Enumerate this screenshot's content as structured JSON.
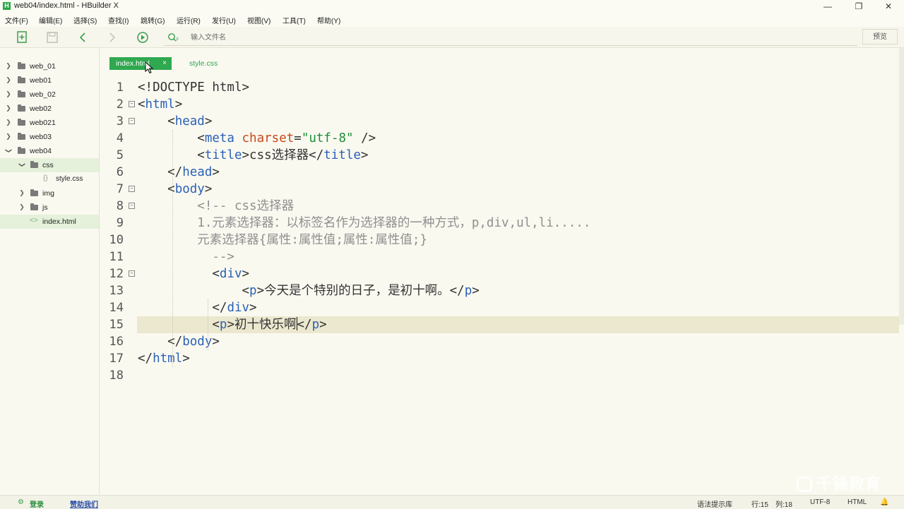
{
  "window": {
    "title": "web04/index.html - HBuilder X",
    "app_icon_letter": "H",
    "minimize": "—",
    "restore": "❐",
    "close": "✕"
  },
  "menu": [
    "文件(F)",
    "编辑(E)",
    "选择(S)",
    "查找(I)",
    "跳转(G)",
    "运行(R)",
    "发行(U)",
    "视图(V)",
    "工具(T)",
    "帮助(Y)"
  ],
  "toolbar": {
    "search_placeholder": "输入文件名",
    "preview_label": "预览",
    "icons": [
      "new-file-icon",
      "save-icon",
      "back-icon",
      "forward-icon",
      "run-icon",
      "search-icon"
    ]
  },
  "sidebar": {
    "items": [
      {
        "label": "web_01",
        "type": "folder",
        "depth": 0,
        "state": "collapsed",
        "selected": false
      },
      {
        "label": "web01",
        "type": "folder",
        "depth": 0,
        "state": "collapsed",
        "selected": false
      },
      {
        "label": "web_02",
        "type": "folder",
        "depth": 0,
        "state": "collapsed",
        "selected": false
      },
      {
        "label": "web02",
        "type": "folder",
        "depth": 0,
        "state": "collapsed",
        "selected": false
      },
      {
        "label": "web021",
        "type": "folder",
        "depth": 0,
        "state": "collapsed",
        "selected": false
      },
      {
        "label": "web03",
        "type": "folder",
        "depth": 0,
        "state": "collapsed",
        "selected": false
      },
      {
        "label": "web04",
        "type": "folder",
        "depth": 0,
        "state": "expanded",
        "selected": false
      },
      {
        "label": "css",
        "type": "folder",
        "depth": 1,
        "state": "expanded",
        "selected": true
      },
      {
        "label": "style.css",
        "type": "css-file",
        "depth": 2,
        "state": "",
        "selected": false
      },
      {
        "label": "img",
        "type": "folder",
        "depth": 1,
        "state": "collapsed",
        "selected": false
      },
      {
        "label": "js",
        "type": "folder",
        "depth": 1,
        "state": "collapsed",
        "selected": false
      },
      {
        "label": "index.html",
        "type": "html-file",
        "depth": 1,
        "state": "",
        "selected": true
      }
    ],
    "css_glyph": "{}",
    "html_glyph": "<>"
  },
  "editor": {
    "tabs": [
      {
        "label": "index.html",
        "active": true,
        "close": "×"
      },
      {
        "label": "style.css",
        "active": false
      }
    ],
    "current_line": 15,
    "lines": [
      {
        "n": "1",
        "fold": "",
        "segments": [
          [
            "pt",
            "<!DOCTYPE html>"
          ]
        ]
      },
      {
        "n": "2",
        "fold": "⊟",
        "segments": [
          [
            "pt",
            "<"
          ],
          [
            "tg",
            "html"
          ],
          [
            "pt",
            ">"
          ]
        ]
      },
      {
        "n": "3",
        "fold": "⊟",
        "segments": [
          [
            "pt",
            "    <"
          ],
          [
            "tg",
            "head"
          ],
          [
            "pt",
            ">"
          ]
        ]
      },
      {
        "n": "4",
        "fold": "",
        "segments": [
          [
            "pt",
            "        <"
          ],
          [
            "tg",
            "meta "
          ],
          [
            "at",
            "charset"
          ],
          [
            "pt",
            "="
          ],
          [
            "st",
            "\"utf-8\""
          ],
          [
            "pt",
            " />"
          ]
        ]
      },
      {
        "n": "5",
        "fold": "",
        "segments": [
          [
            "pt",
            "        <"
          ],
          [
            "tg",
            "title"
          ],
          [
            "pt",
            ">css选择器</"
          ],
          [
            "tg",
            "title"
          ],
          [
            "pt",
            ">"
          ]
        ]
      },
      {
        "n": "6",
        "fold": "",
        "segments": [
          [
            "pt",
            "    </"
          ],
          [
            "tg",
            "head"
          ],
          [
            "pt",
            ">"
          ]
        ]
      },
      {
        "n": "7",
        "fold": "⊟",
        "segments": [
          [
            "pt",
            "    <"
          ],
          [
            "tg",
            "body"
          ],
          [
            "pt",
            ">"
          ]
        ]
      },
      {
        "n": "8",
        "fold": "⊟",
        "segments": [
          [
            "cm",
            "        <!-- css选择器"
          ]
        ]
      },
      {
        "n": "9",
        "fold": "",
        "segments": [
          [
            "cm",
            "        1.元素选择器：以标签名作为选择器的一种方式，p,div,ul,li....."
          ]
        ]
      },
      {
        "n": "10",
        "fold": "",
        "segments": [
          [
            "cm",
            "        元素选择器{属性:属性值;属性:属性值;}"
          ]
        ]
      },
      {
        "n": "11",
        "fold": "",
        "segments": [
          [
            "cm",
            "          -->"
          ]
        ]
      },
      {
        "n": "12",
        "fold": "⊟",
        "segments": [
          [
            "pt",
            "          <"
          ],
          [
            "tg",
            "div"
          ],
          [
            "pt",
            ">"
          ]
        ]
      },
      {
        "n": "13",
        "fold": "",
        "segments": [
          [
            "pt",
            "              <"
          ],
          [
            "tg",
            "p"
          ],
          [
            "pt",
            ">今天是个特别的日子，是初十啊。</"
          ],
          [
            "tg",
            "p"
          ],
          [
            "pt",
            ">"
          ]
        ]
      },
      {
        "n": "14",
        "fold": "",
        "segments": [
          [
            "pt",
            "          </"
          ],
          [
            "tg",
            "div"
          ],
          [
            "pt",
            ">"
          ]
        ]
      },
      {
        "n": "15",
        "fold": "",
        "segments": [
          [
            "pt",
            "          <"
          ],
          [
            "tg",
            "p"
          ],
          [
            "pt",
            ">初十快乐啊"
          ],
          [
            "caret",
            ""
          ],
          [
            "pt",
            "</"
          ],
          [
            "tg",
            "p"
          ],
          [
            "pt",
            ">"
          ]
        ]
      },
      {
        "n": "16",
        "fold": "",
        "segments": [
          [
            "pt",
            "    </"
          ],
          [
            "tg",
            "body"
          ],
          [
            "pt",
            ">"
          ]
        ]
      },
      {
        "n": "17",
        "fold": "",
        "segments": [
          [
            "pt",
            "</"
          ],
          [
            "tg",
            "html"
          ],
          [
            "pt",
            ">"
          ]
        ]
      },
      {
        "n": "18",
        "fold": "",
        "segments": []
      }
    ]
  },
  "status": {
    "login_icon": "gear-icon",
    "login": "登录",
    "sponsor": "赞助我们",
    "syntax_lib": "语法提示库",
    "row": "行:15",
    "col": "列:18",
    "encoding": "UTF-8",
    "language": "HTML",
    "bell_icon": "bell-icon"
  },
  "watermark": "千锋教育"
}
